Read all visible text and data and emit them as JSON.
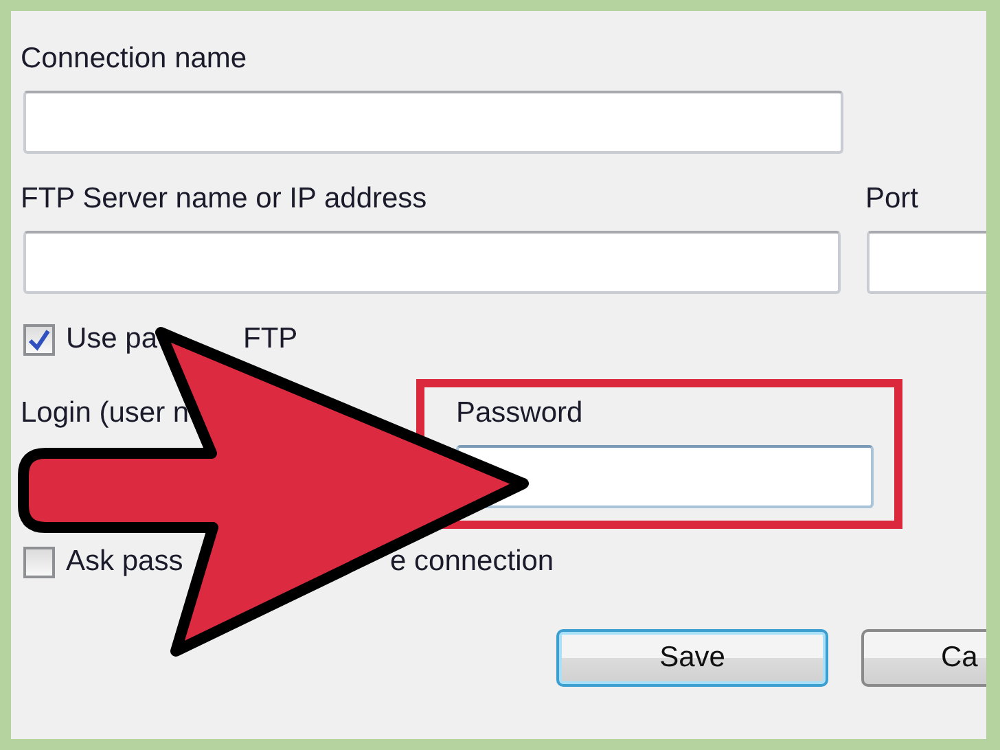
{
  "connection_name": {
    "label": "Connection name"
  },
  "server": {
    "label": "FTP Server name or IP address"
  },
  "port": {
    "label": "Port"
  },
  "passive": {
    "label_parts": [
      "Use pa",
      "FTP"
    ],
    "checked": true
  },
  "login": {
    "label": "Login (user n"
  },
  "password": {
    "label": "Password",
    "highlighted": true
  },
  "ask_password": {
    "label_parts": [
      "Ask pass",
      "e connection"
    ],
    "checked": false
  },
  "buttons": [
    {
      "label": "Save",
      "focused": true
    },
    {
      "label": "Ca",
      "focused": false
    }
  ]
}
